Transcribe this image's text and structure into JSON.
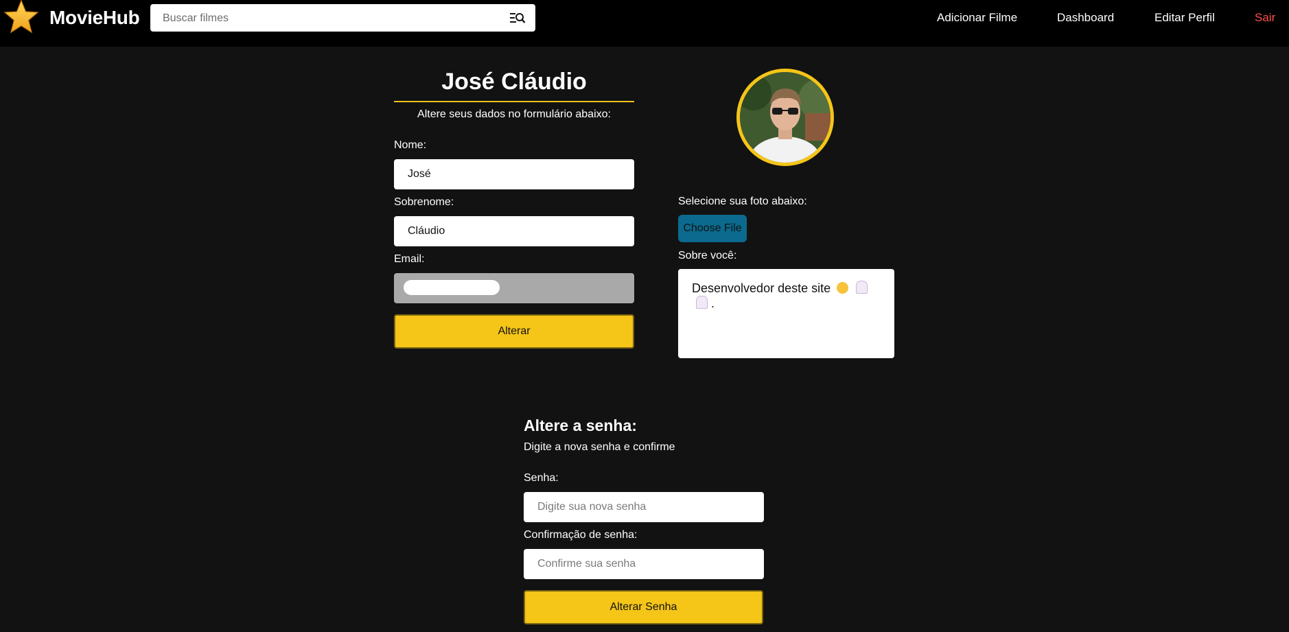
{
  "navbar": {
    "brand": "MovieHub",
    "search_placeholder": "Buscar filmes",
    "links": {
      "add_movie": "Adicionar Filme",
      "dashboard": "Dashboard",
      "edit_profile": "Editar Perfil",
      "logout": "Sair"
    },
    "icons": [
      "star-logo-icon",
      "search-filter-icon"
    ]
  },
  "profile": {
    "name": "José Cláudio",
    "subtitle": "Altere seus dados no formulário abaixo:",
    "first_name_label": "Nome:",
    "first_name_value": "José",
    "last_name_label": "Sobrenome:",
    "last_name_value": "Cláudio",
    "email_label": "Email:",
    "submit_label": "Alterar",
    "photo_label": "Selecione sua foto abaixo:",
    "choose_file_label": "Choose File",
    "bio_label": "Sobre você:",
    "bio_text": "Desenvolvedor deste site",
    "bio_suffix": "."
  },
  "password": {
    "title": "Altere a senha:",
    "subtitle": "Digite a nova senha e confirme",
    "password_label": "Senha:",
    "password_placeholder": "Digite sua nova senha",
    "confirm_label": "Confirmação de senha:",
    "confirm_placeholder": "Confirme sua senha",
    "submit_label": "Alterar Senha"
  },
  "colors": {
    "accent": "#f5c518",
    "background": "#121212",
    "navbar": "#000000",
    "logout": "#ff4d4d",
    "file_button": "#0b6a8e"
  }
}
